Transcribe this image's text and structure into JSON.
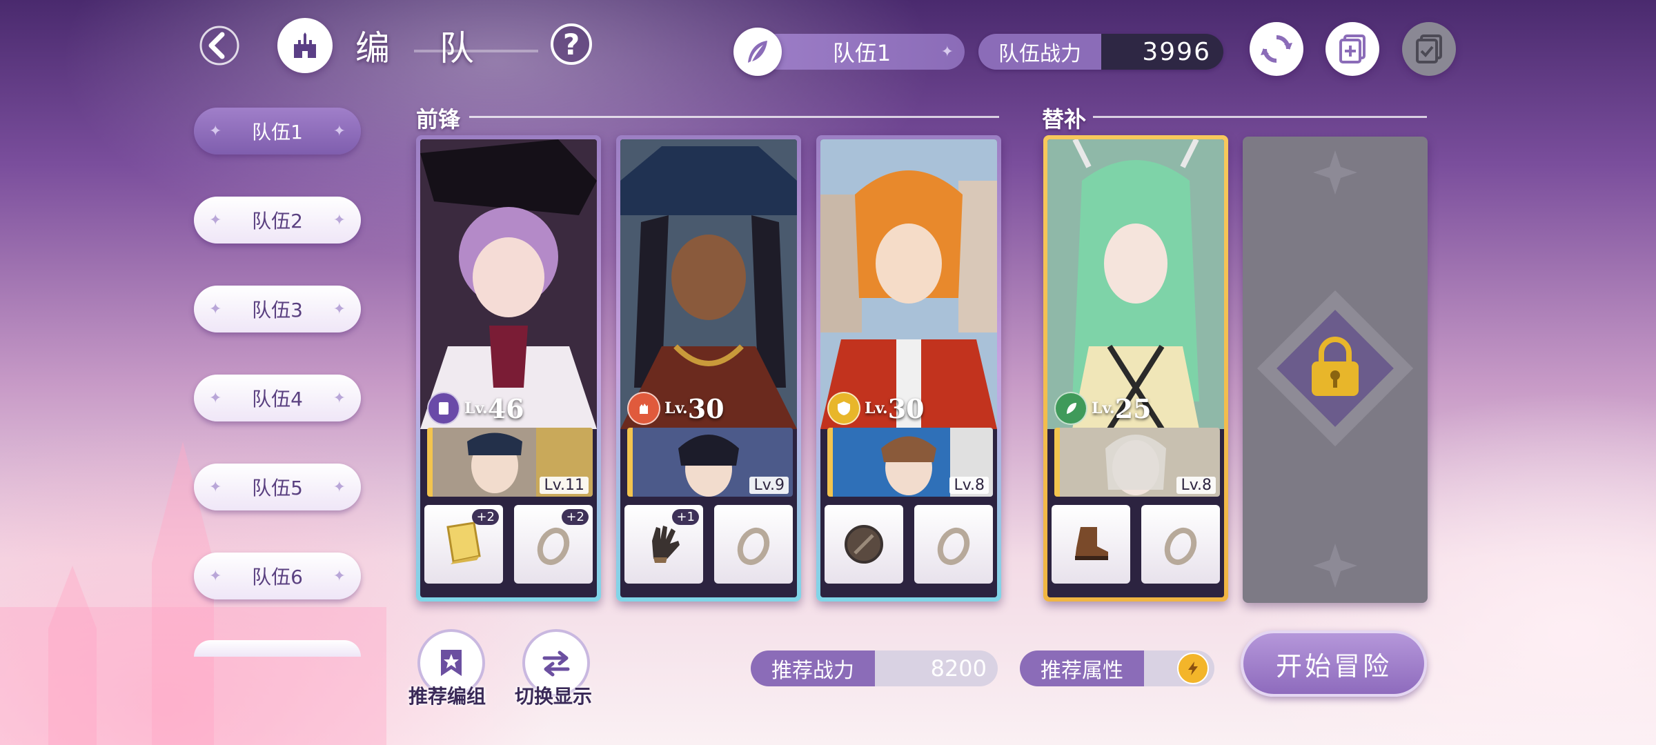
{
  "header": {
    "title": "编 队",
    "help_label": "?",
    "team_selector": "队伍1",
    "power_label": "队伍战力",
    "power_value": "3996"
  },
  "sidebar": {
    "teams": [
      {
        "label": "队伍1",
        "active": true
      },
      {
        "label": "队伍2",
        "active": false
      },
      {
        "label": "队伍3",
        "active": false
      },
      {
        "label": "队伍4",
        "active": false
      },
      {
        "label": "队伍5",
        "active": false
      },
      {
        "label": "队伍6",
        "active": false
      }
    ]
  },
  "sections": {
    "front": "前锋",
    "sub": "替补"
  },
  "cards": [
    {
      "level_prefix": "Lv.",
      "level": "46",
      "attr_color": "#6a4aa8",
      "support_level": "Lv.11",
      "equip": [
        {
          "icon": "book-icon",
          "plus": "+2"
        },
        {
          "icon": "ring-icon",
          "plus": "+2"
        }
      ]
    },
    {
      "level_prefix": "Lv.",
      "level": "30",
      "attr_color": "#e05a3c",
      "support_level": "Lv.9",
      "equip": [
        {
          "icon": "glove-icon",
          "plus": "+1"
        },
        {
          "icon": "ring-icon",
          "plus": ""
        }
      ]
    },
    {
      "level_prefix": "Lv.",
      "level": "30",
      "attr_color": "#e8b62a",
      "support_level": "Lv.8",
      "equip": [
        {
          "icon": "shield-icon",
          "plus": ""
        },
        {
          "icon": "ring-icon",
          "plus": ""
        }
      ]
    },
    {
      "level_prefix": "Lv.",
      "level": "25",
      "attr_color": "#3f9a5a",
      "support_level": "Lv.8",
      "equip": [
        {
          "icon": "boot-icon",
          "plus": ""
        },
        {
          "icon": "ring-icon",
          "plus": ""
        }
      ]
    }
  ],
  "bottom": {
    "recommend_team_label": "推荐编组",
    "switch_display_label": "切换显示",
    "recommend_power_label": "推荐战力",
    "recommend_power_value": "8200",
    "recommend_attr_label": "推荐属性",
    "start_label": "开始冒险"
  },
  "colors": {
    "accent": "#8b6cb8",
    "dark_panel": "#2e2744",
    "gold": "#f3c44e"
  }
}
